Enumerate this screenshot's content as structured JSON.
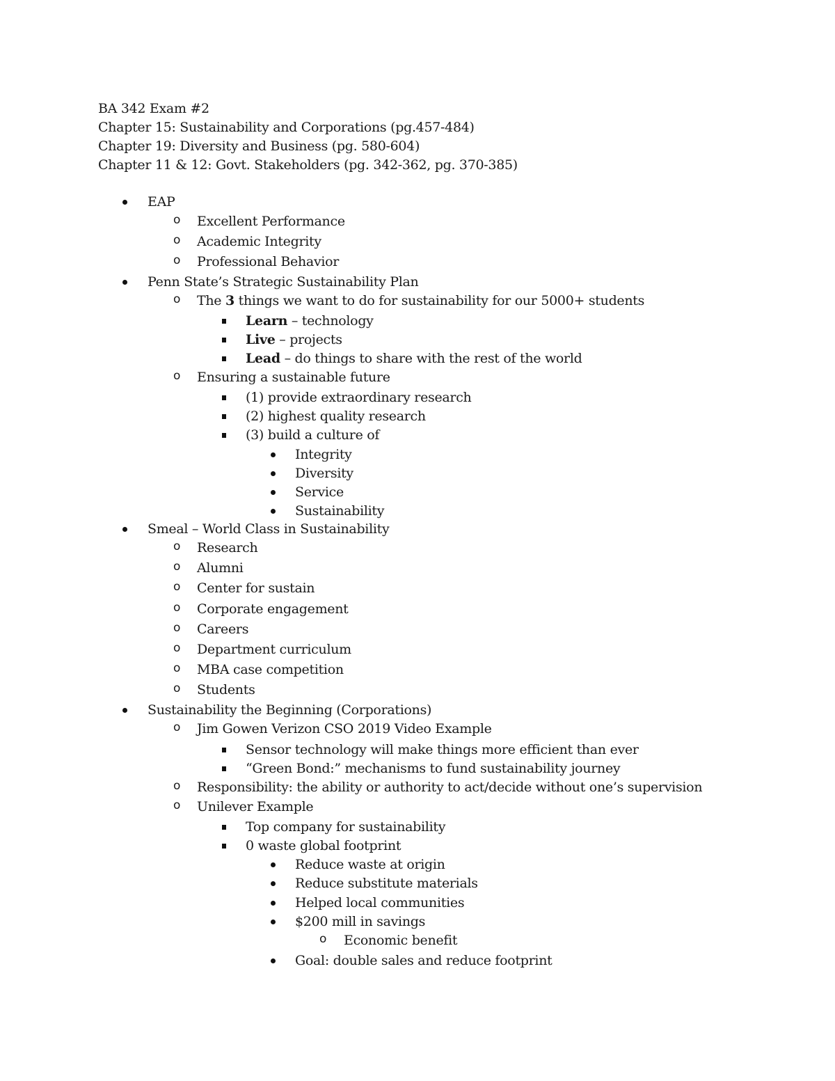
{
  "header": {
    "title": "BA 342 Exam #2",
    "chapters": [
      "Chapter 15: Sustainability and Corporations (pg.457-484)",
      "Chapter 19: Diversity and Business (pg. 580-604)",
      "Chapter 11 & 12: Govt. Stakeholders (pg. 342-362, pg. 370-385)"
    ]
  },
  "outline": [
    {
      "level": 1,
      "marker": "disc",
      "text": "EAP"
    },
    {
      "level": 2,
      "marker": "circle",
      "text": "Excellent Performance"
    },
    {
      "level": 2,
      "marker": "circle",
      "text": "Academic Integrity"
    },
    {
      "level": 2,
      "marker": "circle",
      "text": "Professional Behavior"
    },
    {
      "level": 1,
      "marker": "disc",
      "text": "Penn State’s Strategic Sustainability Plan"
    },
    {
      "level": 2,
      "marker": "circle",
      "pre": "The ",
      "bold": "3",
      "text": " things we want to do for sustainability for our 5000+ students"
    },
    {
      "level": 3,
      "marker": "square",
      "bold": "Learn",
      "text": " – technology"
    },
    {
      "level": 3,
      "marker": "square",
      "bold": "Live",
      "text": " – projects"
    },
    {
      "level": 3,
      "marker": "square",
      "bold": "Lead",
      "text": " – do things to share with the rest of the world"
    },
    {
      "level": 2,
      "marker": "circle",
      "text": "Ensuring a sustainable future"
    },
    {
      "level": 3,
      "marker": "square",
      "text": "(1) provide extraordinary research"
    },
    {
      "level": 3,
      "marker": "square",
      "text": "(2) highest quality research"
    },
    {
      "level": 3,
      "marker": "square",
      "text": "(3) build a culture of"
    },
    {
      "level": 4,
      "marker": "disc",
      "text": "Integrity"
    },
    {
      "level": 4,
      "marker": "disc",
      "text": "Diversity"
    },
    {
      "level": 4,
      "marker": "disc",
      "text": "Service"
    },
    {
      "level": 4,
      "marker": "disc",
      "text": "Sustainability"
    },
    {
      "level": 1,
      "marker": "disc",
      "text": "Smeal – World Class in Sustainability"
    },
    {
      "level": 2,
      "marker": "circle",
      "text": "Research"
    },
    {
      "level": 2,
      "marker": "circle",
      "text": "Alumni"
    },
    {
      "level": 2,
      "marker": "circle",
      "text": "Center for sustain"
    },
    {
      "level": 2,
      "marker": "circle",
      "text": "Corporate engagement"
    },
    {
      "level": 2,
      "marker": "circle",
      "text": "Careers"
    },
    {
      "level": 2,
      "marker": "circle",
      "text": "Department curriculum"
    },
    {
      "level": 2,
      "marker": "circle",
      "text": "MBA case competition"
    },
    {
      "level": 2,
      "marker": "circle",
      "text": "Students"
    },
    {
      "level": 1,
      "marker": "disc",
      "text": "Sustainability the Beginning (Corporations)"
    },
    {
      "level": 2,
      "marker": "circle",
      "text": "Jim Gowen Verizon CSO 2019 Video Example"
    },
    {
      "level": 3,
      "marker": "square",
      "text": "Sensor technology will make things more efficient than ever"
    },
    {
      "level": 3,
      "marker": "square",
      "text": "“Green Bond:” mechanisms to fund sustainability journey"
    },
    {
      "level": 2,
      "marker": "circle",
      "text": "Responsibility: the ability or authority to act/decide without one’s supervision"
    },
    {
      "level": 2,
      "marker": "circle",
      "text": "Unilever Example"
    },
    {
      "level": 3,
      "marker": "square",
      "text": "Top company for sustainability"
    },
    {
      "level": 3,
      "marker": "square",
      "text": "0 waste global footprint"
    },
    {
      "level": 4,
      "marker": "disc",
      "text": "Reduce waste at origin"
    },
    {
      "level": 4,
      "marker": "disc",
      "text": "Reduce substitute materials"
    },
    {
      "level": 4,
      "marker": "disc",
      "text": "Helped local communities"
    },
    {
      "level": 4,
      "marker": "disc",
      "text": "$200 mill in savings"
    },
    {
      "level": 5,
      "marker": "circle",
      "text": "Economic benefit"
    },
    {
      "level": 4,
      "marker": "disc",
      "text": "Goal: double sales and reduce footprint"
    }
  ],
  "circle_glyph": "o"
}
